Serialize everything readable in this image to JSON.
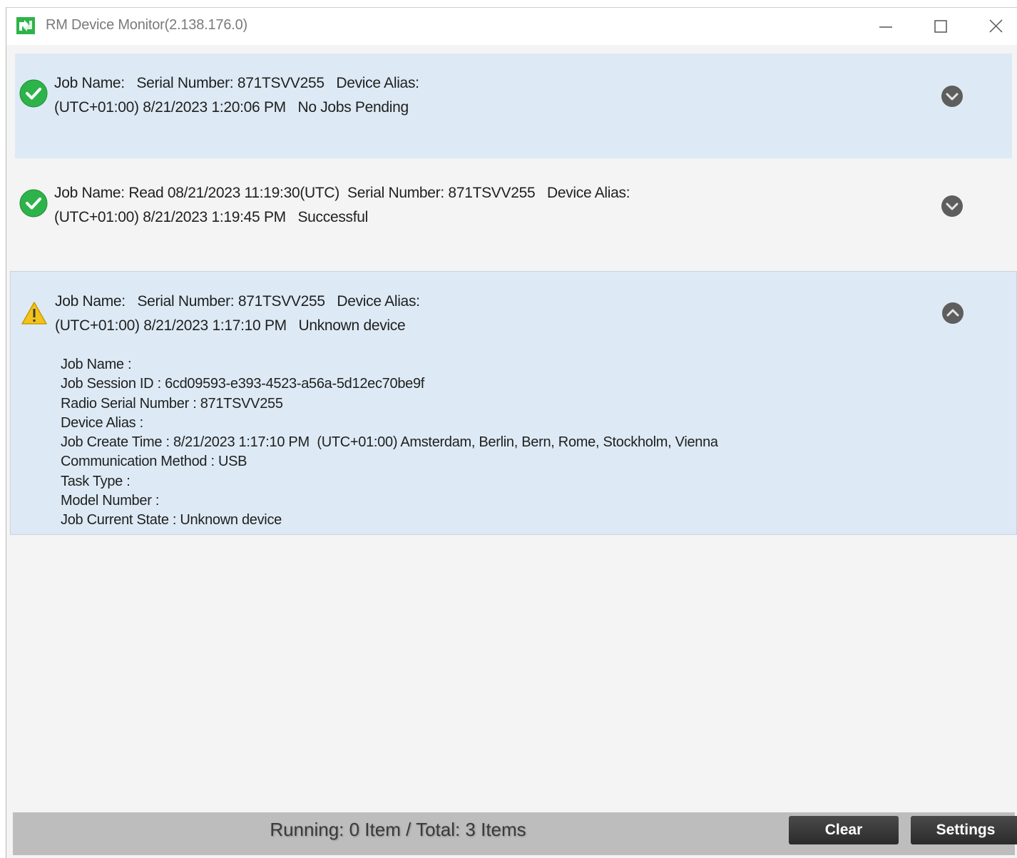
{
  "window": {
    "title": "RM Device Monitor(2.138.176.0)"
  },
  "jobs": [
    {
      "status": "success",
      "line1": "Job Name:   Serial Number: 871TSVV255   Device Alias:",
      "line2": "(UTC+01:00) 8/21/2023 1:20:06 PM   No Jobs Pending",
      "expanded": false
    },
    {
      "status": "success",
      "line1": "Job Name: Read 08/21/2023 11:19:30(UTC)  Serial Number: 871TSVV255   Device Alias:",
      "line2": "(UTC+01:00) 8/21/2023 1:19:45 PM   Successful",
      "expanded": false
    },
    {
      "status": "warning",
      "line1": "Job Name:   Serial Number: 871TSVV255   Device Alias:",
      "line2": "(UTC+01:00) 8/21/2023 1:17:10 PM   Unknown device",
      "expanded": true,
      "details": [
        "Job Name :",
        "Job Session ID : 6cd09593-e393-4523-a56a-5d12ec70be9f",
        "Radio Serial Number : 871TSVV255",
        "Device Alias :",
        "Job Create Time : 8/21/2023 1:17:10 PM  (UTC+01:00) Amsterdam, Berlin, Bern, Rome, Stockholm, Vienna",
        "Communication Method : USB",
        "Task Type :",
        "Model Number :",
        "Job Current State : Unknown device"
      ]
    }
  ],
  "footer": {
    "status": "Running: 0 Item / Total: 3 Items",
    "clear_label": "Clear",
    "settings_label": "Settings"
  },
  "icons": {
    "app": "rm-app-icon",
    "success": "check-circle-icon",
    "warning": "warning-triangle-icon",
    "expand": "chevron-down-circle-icon",
    "collapse": "chevron-up-circle-icon"
  },
  "colors": {
    "success_green": "#2db34a",
    "warning_yellow": "#f2c318",
    "selected_row": "#ddeaf5",
    "footer_bar": "#bdbdbd",
    "button_dark": "#333333"
  }
}
